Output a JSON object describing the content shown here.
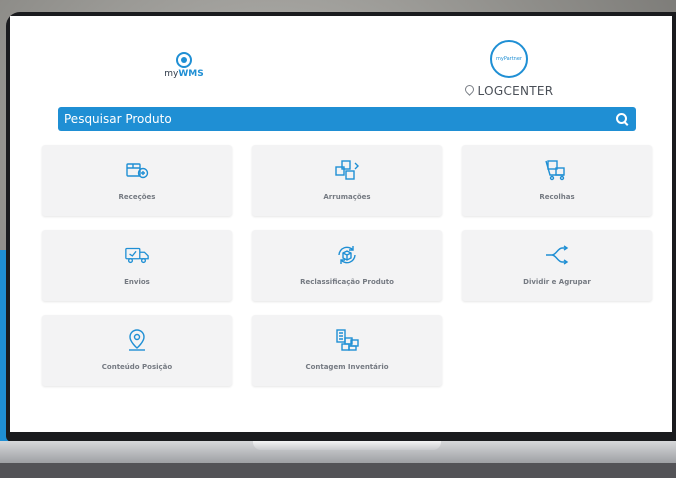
{
  "app": {
    "brand": {
      "prefix": "my",
      "name": "WMS"
    },
    "company": {
      "location": "LOGCENTER",
      "logo_text": "myPartner"
    }
  },
  "search": {
    "placeholder": "Pesquisar Produto"
  },
  "menu": {
    "tiles": [
      {
        "label": "Receções",
        "icon": "receive-box-icon"
      },
      {
        "label": "Arrumações",
        "icon": "boxes-stack-icon"
      },
      {
        "label": "Recolhas",
        "icon": "pick-cart-icon"
      },
      {
        "label": "Envios",
        "icon": "delivery-truck-icon"
      },
      {
        "label": "Reclassificação Produto",
        "icon": "reclassify-icon"
      },
      {
        "label": "Dividir e Agrupar",
        "icon": "split-merge-icon"
      },
      {
        "label": "Conteúdo Posição",
        "icon": "location-pin-icon"
      },
      {
        "label": "Contagem Inventário",
        "icon": "inventory-count-icon"
      }
    ]
  },
  "colors": {
    "accent": "#1f8fd4",
    "tile_bg": "#f3f3f4",
    "tile_text": "#757a82"
  }
}
